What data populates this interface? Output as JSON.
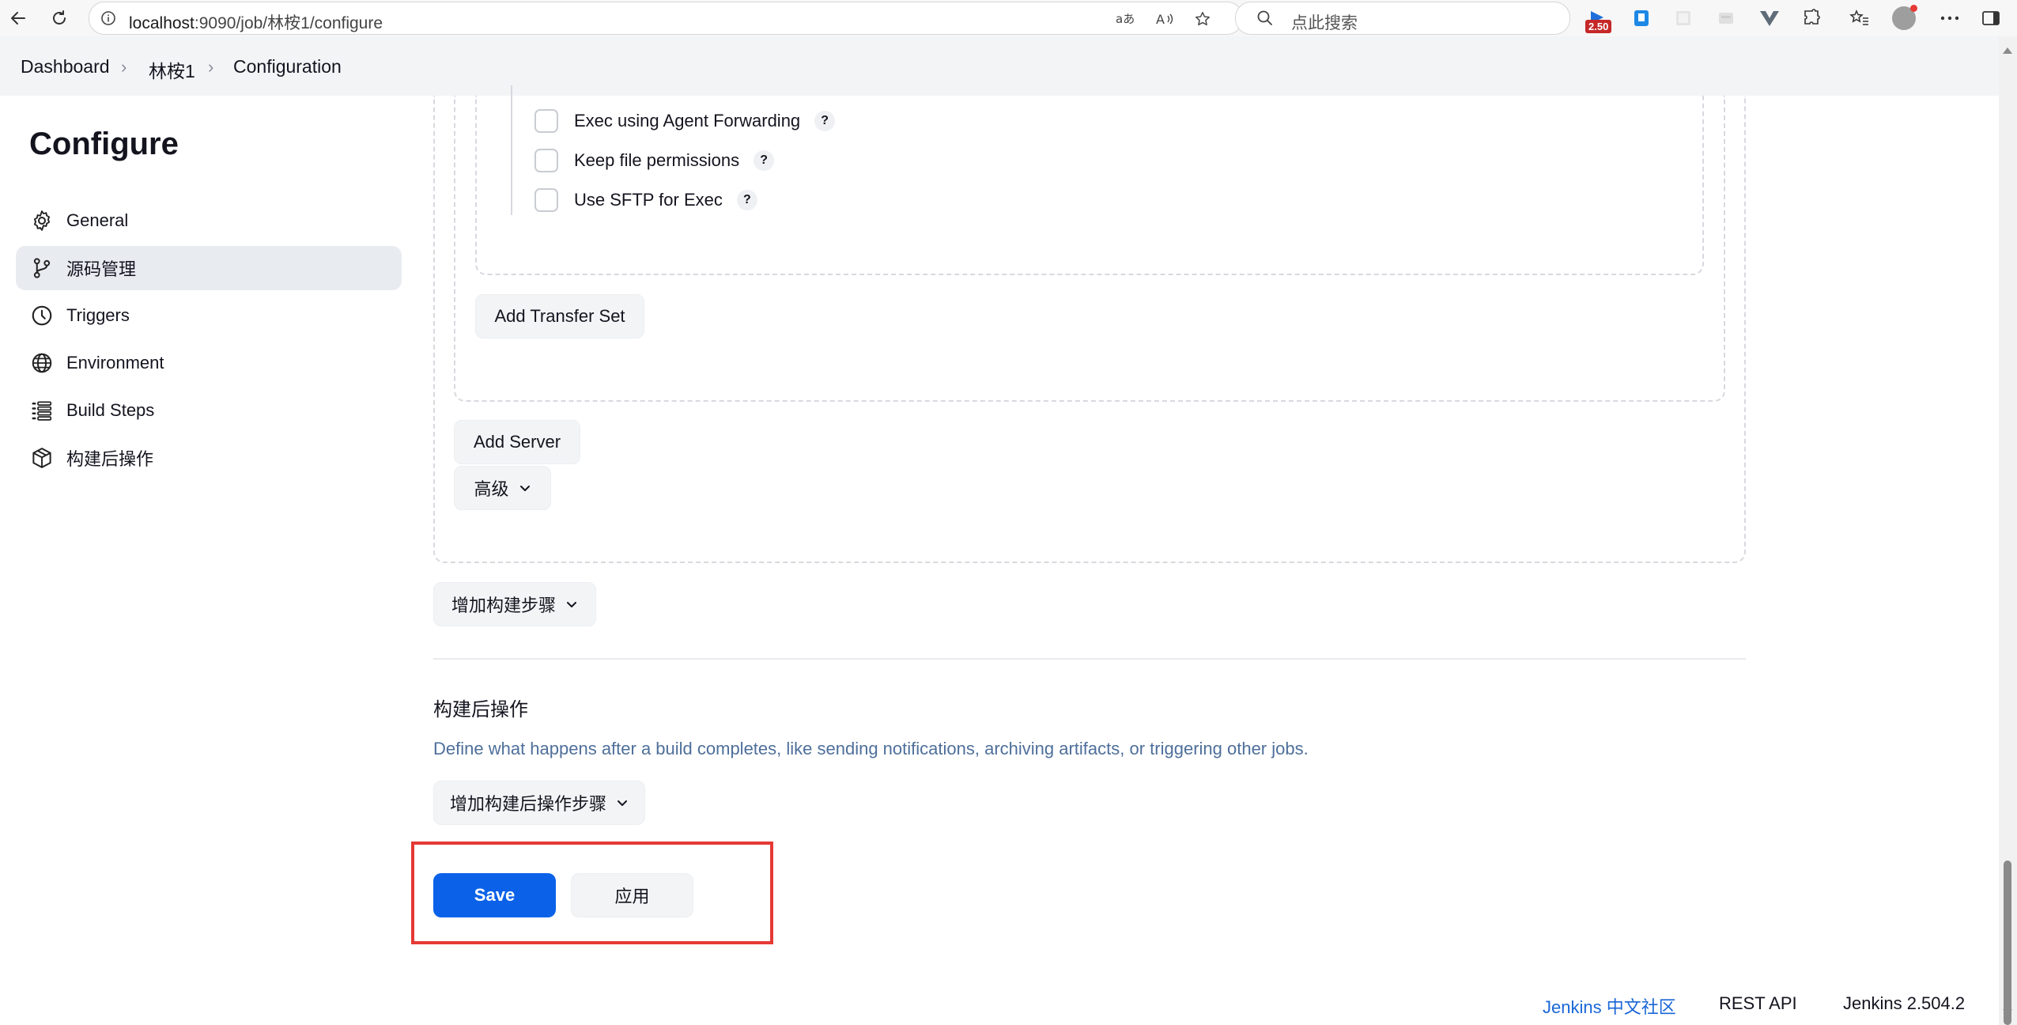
{
  "browser": {
    "url_host": "localhost",
    "url_path": ":9090/job/林桉1/configure",
    "search_placeholder": "点此搜索",
    "ext_badge": "2.50"
  },
  "breadcrumb": {
    "items": [
      "Dashboard",
      "林桉1",
      "Configuration"
    ]
  },
  "sidebar": {
    "title": "Configure",
    "items": [
      {
        "label": "General",
        "icon": "gear-icon"
      },
      {
        "label": "源码管理",
        "icon": "git-branch-icon"
      },
      {
        "label": "Triggers",
        "icon": "clock-icon"
      },
      {
        "label": "Environment",
        "icon": "globe-icon"
      },
      {
        "label": "Build Steps",
        "icon": "list-icon"
      },
      {
        "label": "构建后操作",
        "icon": "package-icon"
      }
    ],
    "active_index": 1
  },
  "main": {
    "checkboxes": [
      {
        "label": "Exec using Agent Forwarding",
        "checked": false
      },
      {
        "label": "Keep file permissions",
        "checked": false
      },
      {
        "label": "Use SFTP for Exec",
        "checked": false
      }
    ],
    "help_glyph": "?",
    "add_transfer_set": "Add Transfer Set",
    "add_server": "Add Server",
    "advanced": "高级",
    "add_build_step": "增加构建步骤",
    "post_build": {
      "title": "构建后操作",
      "description": "Define what happens after a build completes, like sending notifications, archiving artifacts, or triggering other jobs.",
      "add_step": "增加构建后操作步骤"
    },
    "save": "Save",
    "apply": "应用"
  },
  "footer": {
    "community": "Jenkins 中文社区",
    "rest_api": "REST API",
    "version": "Jenkins 2.504.2"
  },
  "colors": {
    "primary": "#0b62e8",
    "highlight_box": "#e53935",
    "link": "#1a66d6"
  }
}
